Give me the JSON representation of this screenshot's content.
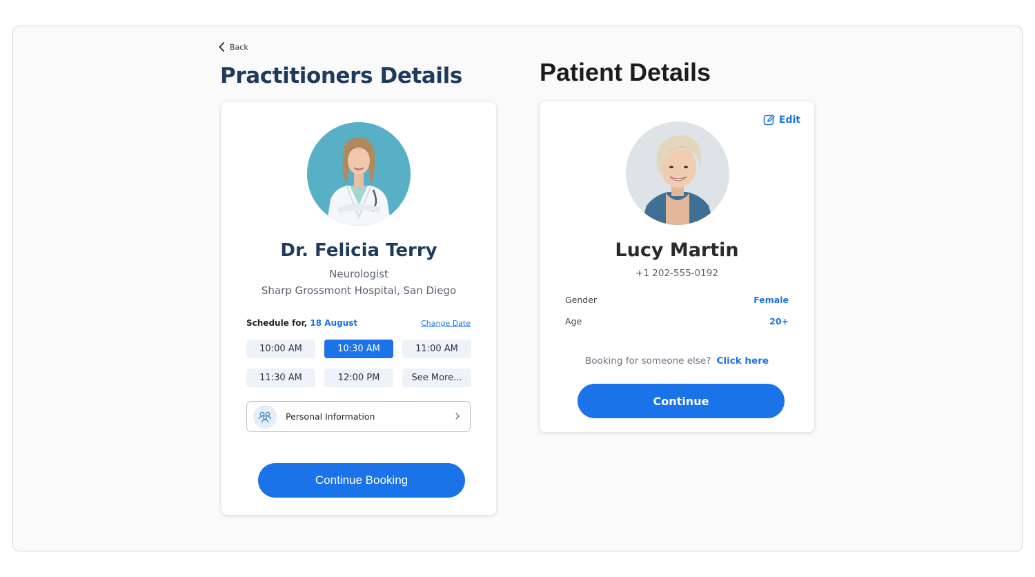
{
  "nav": {
    "back_label": "Back"
  },
  "practitioner": {
    "section_title": "Practitioners Details",
    "name": "Dr. Felicia Terry",
    "specialty": "Neurologist",
    "hospital": "Sharp Grossmont Hospital, San Diego",
    "schedule_label": "Schedule for,",
    "schedule_date": "18 August",
    "change_date_label": "Change Date",
    "slots": [
      {
        "label": "10:00 AM",
        "selected": false
      },
      {
        "label": "10:30 AM",
        "selected": true
      },
      {
        "label": "11:00 AM",
        "selected": false
      },
      {
        "label": "11:30 AM",
        "selected": false
      },
      {
        "label": "12:00 PM",
        "selected": false
      },
      {
        "label": "See More...",
        "selected": false
      }
    ],
    "personal_info_label": "Personal Information",
    "continue_label": "Continue Booking"
  },
  "patient": {
    "section_title": "Patient Details",
    "edit_label": "Edit",
    "name": "Lucy Martin",
    "phone": "+1 202-555-0192",
    "gender_label": "Gender",
    "gender_value": "Female",
    "age_label": "Age",
    "age_value": "20+",
    "booking_else_text": "Booking for someone else?",
    "booking_else_link": "Click here",
    "continue_label": "Continue"
  },
  "colors": {
    "accent": "#1a73e8",
    "practitioner_title": "#1e3a5f",
    "slot_bg": "#eef3f9",
    "frame_bg": "#fafafa"
  },
  "icons": [
    "chevron-left-icon",
    "people-icon",
    "chevron-right-icon",
    "edit-icon"
  ]
}
